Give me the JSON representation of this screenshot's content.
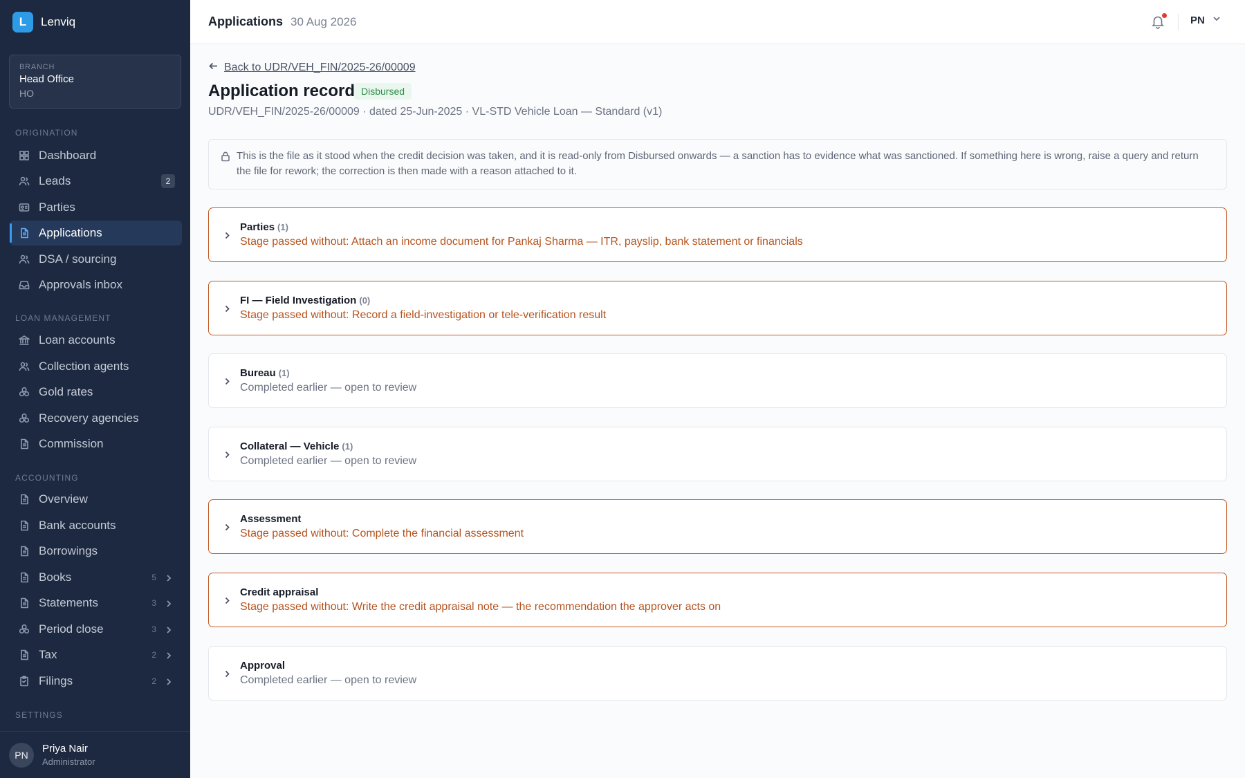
{
  "app": {
    "logo_letter": "L",
    "name": "Lenviq"
  },
  "branch": {
    "label": "BRANCH",
    "name": "Head Office",
    "code": "HO"
  },
  "sidebar": {
    "sections": {
      "origination": "ORIGINATION",
      "loan_management": "LOAN MANAGEMENT",
      "accounting": "ACCOUNTING",
      "settings": "SETTINGS"
    },
    "items": [
      {
        "label": "Dashboard",
        "icon": "grid-icon"
      },
      {
        "label": "Leads",
        "icon": "users-icon",
        "badge": "2"
      },
      {
        "label": "Parties",
        "icon": "id-card-icon"
      },
      {
        "label": "Applications",
        "icon": "document-icon",
        "active": true
      },
      {
        "label": "DSA / sourcing",
        "icon": "users-icon"
      },
      {
        "label": "Approvals inbox",
        "icon": "inbox-icon"
      },
      {
        "label": "Loan accounts",
        "icon": "bank-icon"
      },
      {
        "label": "Collection agents",
        "icon": "users-icon"
      },
      {
        "label": "Gold rates",
        "icon": "coins-icon"
      },
      {
        "label": "Recovery agencies",
        "icon": "coins-icon"
      },
      {
        "label": "Commission",
        "icon": "document-icon"
      },
      {
        "label": "Overview",
        "icon": "document-icon"
      },
      {
        "label": "Bank accounts",
        "icon": "document-icon"
      },
      {
        "label": "Borrowings",
        "icon": "document-icon"
      },
      {
        "label": "Books",
        "icon": "document-icon",
        "count": "5"
      },
      {
        "label": "Statements",
        "icon": "document-icon",
        "count": "3"
      },
      {
        "label": "Period close",
        "icon": "coins-icon",
        "count": "3"
      },
      {
        "label": "Tax",
        "icon": "document-icon",
        "count": "2"
      },
      {
        "label": "Filings",
        "icon": "clipboard-icon",
        "count": "2"
      }
    ]
  },
  "user": {
    "initials": "PN",
    "name": "Priya Nair",
    "role": "Administrator"
  },
  "topbar": {
    "title": "Applications",
    "date": "30 Aug 2026",
    "user_initials": "PN"
  },
  "page": {
    "back_link": "Back to UDR/VEH_FIN/2025-26/00009",
    "title": "Application record",
    "status": "Disbursed",
    "subline": "UDR/VEH_FIN/2025-26/00009 · dated 25-Jun-2025 · VL-STD Vehicle Loan — Standard (v1)",
    "notice": "This is the file as it stood when the credit decision was taken, and it is read-only from Disbursed onwards — a sanction has to evidence what was sanctioned. If something here is wrong, raise a query and return the file for rework; the correction is then made with a reason attached to it."
  },
  "stages": [
    {
      "title": "Parties",
      "count": "(1)",
      "subtitle": "Stage passed without: Attach an income document for Pankaj Sharma — ITR, payslip, bank statement or financials",
      "warning": true
    },
    {
      "title": "FI — Field Investigation",
      "count": "(0)",
      "subtitle": "Stage passed without: Record a field-investigation or tele-verification result",
      "warning": true
    },
    {
      "title": "Bureau",
      "count": "(1)",
      "subtitle": "Completed earlier — open to review",
      "warning": false
    },
    {
      "title": "Collateral — Vehicle",
      "count": "(1)",
      "subtitle": "Completed earlier — open to review",
      "warning": false
    },
    {
      "title": "Assessment",
      "count": "",
      "subtitle": "Stage passed without: Complete the financial assessment",
      "warning": true
    },
    {
      "title": "Credit appraisal",
      "count": "",
      "subtitle": "Stage passed without: Write the credit appraisal note — the recommendation the approver acts on",
      "warning": true
    },
    {
      "title": "Approval",
      "count": "",
      "subtitle": "Completed earlier — open to review",
      "warning": false
    }
  ],
  "colors": {
    "sidebar_bg": "#1d2940",
    "accent": "#2e9be6",
    "warning": "#c25a27",
    "status_green": "#2d8a4a"
  }
}
